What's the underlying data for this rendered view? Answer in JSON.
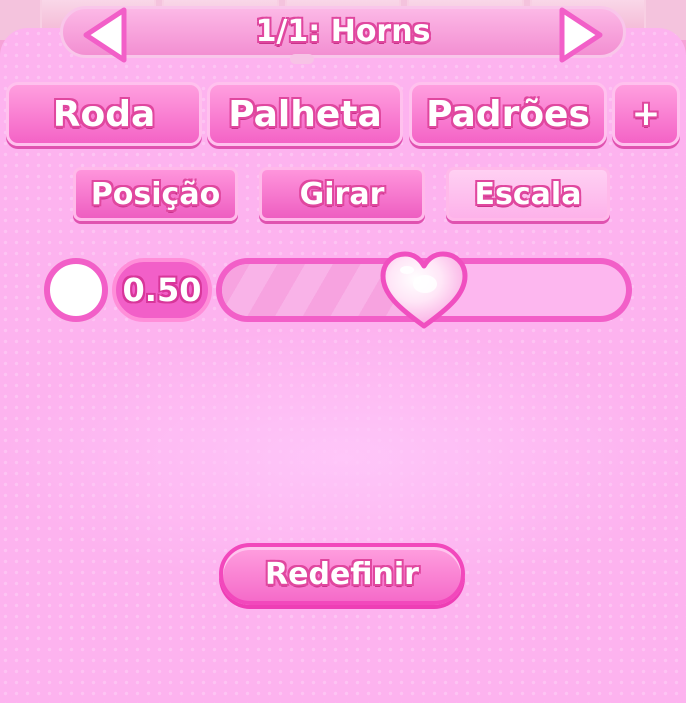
{
  "header": {
    "title": "1/1: Horns",
    "prev_icon": "triangle-left-icon",
    "next_icon": "triangle-right-icon"
  },
  "tabs": [
    {
      "label": "Roda"
    },
    {
      "label": "Palheta"
    },
    {
      "label": "Padrões"
    },
    {
      "label": "+"
    }
  ],
  "subtabs": [
    {
      "label": "Posição"
    },
    {
      "label": "Girar"
    },
    {
      "label": "Escala",
      "active": true
    }
  ],
  "scale": {
    "value_text": "0.50",
    "value": 0.5,
    "swatch_color": "#ffffff",
    "thumb_icon": "heart-icon"
  },
  "reset_label": "Redefinir",
  "colors": {
    "panel": "#fdb3ef",
    "accent": "#f25fc8",
    "text_outline": "#e0479f"
  }
}
